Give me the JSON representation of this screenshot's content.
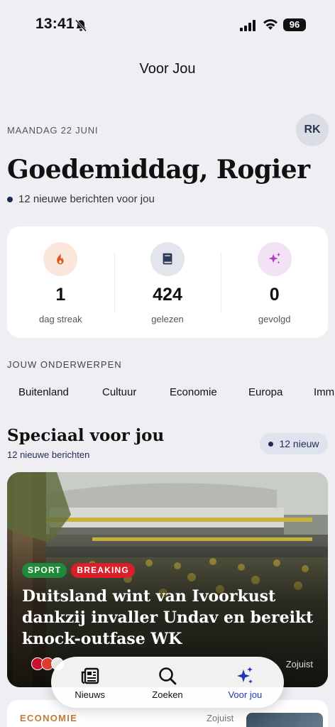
{
  "status_bar": {
    "time": "13:41",
    "battery": "96"
  },
  "header": {
    "title": "Voor Jou"
  },
  "greeting": {
    "date": "MAANDAG 22 JUNI",
    "avatar_initials": "RK",
    "title": "Goedemiddag, Rogier",
    "new_messages": "12 nieuwe berichten voor jou"
  },
  "stats": [
    {
      "icon": "fire-icon",
      "value": "1",
      "label": "dag streak"
    },
    {
      "icon": "book-icon",
      "value": "424",
      "label": "gelezen"
    },
    {
      "icon": "sparkle-icon",
      "value": "0",
      "label": "gevolgd"
    }
  ],
  "topics": {
    "label": "JOUW ONDERWERPEN",
    "items": [
      "Buitenland",
      "Cultuur",
      "Economie",
      "Europa",
      "Imm"
    ]
  },
  "special": {
    "title": "Speciaal voor jou",
    "subtitle": "12 nieuwe berichten",
    "new_badge": "12 nieuw"
  },
  "hero": {
    "tags": [
      "SPORT",
      "BREAKING"
    ],
    "title": "Duitsland wint van Ivoorkust dankzij invaller Undav en bereikt knock-outfase WK",
    "time": "Zojuist"
  },
  "next_card": {
    "tag": "ECONOMIE",
    "time": "Zojuist"
  },
  "tabbar": {
    "tabs": [
      {
        "label": "Nieuws",
        "icon": "newspaper-icon"
      },
      {
        "label": "Zoeken",
        "icon": "search-icon"
      },
      {
        "label": "Voor jou",
        "icon": "sparkle-icon"
      }
    ]
  },
  "colors": {
    "background": "#eeeef3",
    "accent": "#1f2b55",
    "sport": "#1f8a3a",
    "breaking": "#d91f2a",
    "economie": "#c27c35",
    "active_tab": "#1f3bb0"
  }
}
